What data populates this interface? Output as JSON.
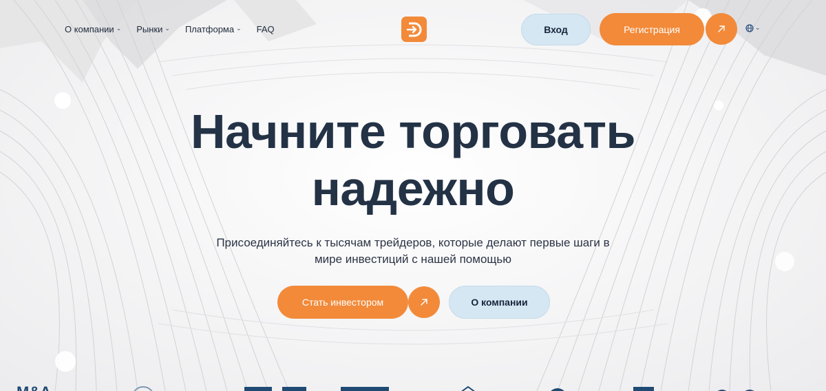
{
  "nav": {
    "items": [
      {
        "label": "О компании",
        "has_dropdown": true
      },
      {
        "label": "Рынки",
        "has_dropdown": true
      },
      {
        "label": "Платформа",
        "has_dropdown": true
      },
      {
        "label": "FAQ",
        "has_dropdown": false
      }
    ],
    "chevron_glyph": "⌄"
  },
  "header": {
    "login_label": "Вход",
    "register_label": "Регистрация",
    "language_icon": "globe-icon"
  },
  "hero": {
    "title_line1": "Начните торговать",
    "title_line2": "надежно",
    "subtitle_line1": "Присоединяйтесь к тысячам трейдеров, которые делают первые шаги в",
    "subtitle_line2": "мире инвестиций с нашей помощью",
    "primary_button": "Стать инвестором",
    "secondary_button": "О компании"
  },
  "partners": {
    "first_logo_text": "M&A"
  },
  "colors": {
    "accent": "#f28a3a",
    "secondary_button": "#d5e7f3",
    "title": "#243246",
    "text": "#2b3444"
  }
}
